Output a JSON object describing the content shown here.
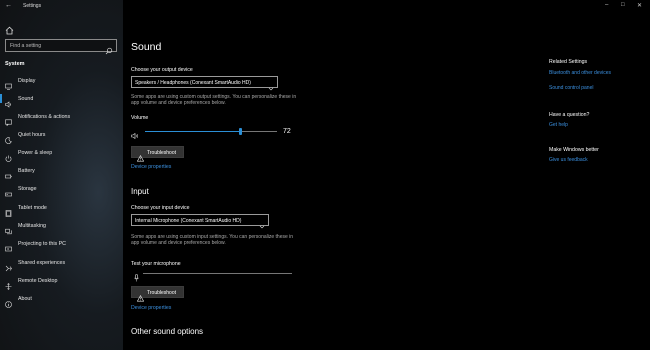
{
  "window": {
    "title": "Settings"
  },
  "sidebar": {
    "search_placeholder": "Find a setting",
    "section": "System",
    "items": [
      {
        "label": "Display",
        "icon": "display-icon"
      },
      {
        "label": "Sound",
        "icon": "speaker-icon",
        "active": true
      },
      {
        "label": "Notifications & actions",
        "icon": "notifications-icon"
      },
      {
        "label": "Quiet hours",
        "icon": "moon-icon"
      },
      {
        "label": "Power & sleep",
        "icon": "power-icon"
      },
      {
        "label": "Battery",
        "icon": "battery-icon"
      },
      {
        "label": "Storage",
        "icon": "storage-icon"
      },
      {
        "label": "Tablet mode",
        "icon": "tablet-icon"
      },
      {
        "label": "Multitasking",
        "icon": "multitasking-icon"
      },
      {
        "label": "Projecting to this PC",
        "icon": "projecting-icon"
      },
      {
        "label": "Shared experiences",
        "icon": "shared-icon"
      },
      {
        "label": "Remote Desktop",
        "icon": "remote-icon"
      },
      {
        "label": "About",
        "icon": "info-icon"
      }
    ]
  },
  "main": {
    "title": "Sound",
    "output": {
      "label": "Choose your output device",
      "device": "Speakers / Headphones (Conexant SmartAudio HD)",
      "note": "Some apps are using custom output settings. You can personalize these in app volume and device preferences below.",
      "volume_label": "Volume",
      "volume_value": "72",
      "volume_fraction": 0.72,
      "troubleshoot": "Troubleshoot",
      "device_properties": "Device properties"
    },
    "input": {
      "title": "Input",
      "label": "Choose your input device",
      "device": "Internal Microphone (Conexant SmartAudio HD)",
      "note": "Some apps are using custom input settings. You can personalize these in app volume and device preferences below.",
      "test_label": "Test your microphone",
      "troubleshoot": "Troubleshoot",
      "device_properties": "Device properties"
    },
    "other": {
      "title": "Other sound options"
    }
  },
  "right": {
    "related_title": "Related Settings",
    "related_links": [
      "Bluetooth and other devices",
      "Sound control panel"
    ],
    "question_title": "Have a question?",
    "question_link": "Get help",
    "better_title": "Make Windows better",
    "better_link": "Give us feedback"
  },
  "colors": {
    "accent": "#2b8fd6",
    "link": "#3b8fde",
    "background": "#000000"
  }
}
